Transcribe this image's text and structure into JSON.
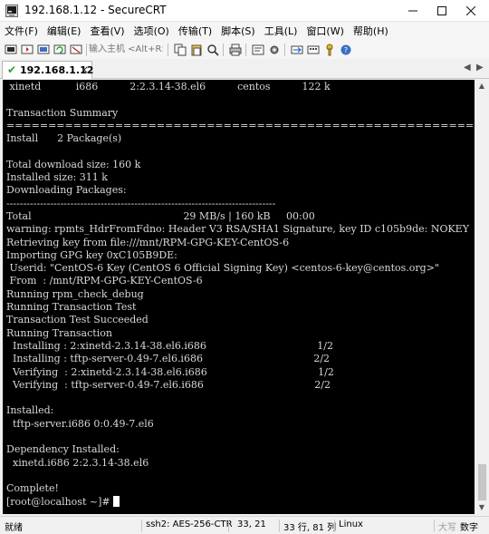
{
  "window": {
    "title": "192.168.1.12 - SecureCRT"
  },
  "menu": [
    "文件(F)",
    "编辑(E)",
    "查看(V)",
    "选项(O)",
    "传输(T)",
    "脚本(S)",
    "工具(L)",
    "窗口(W)",
    "帮助(H)"
  ],
  "toolbar": {
    "quick_connect_placeholder": "输入主机 <Alt+R>"
  },
  "tab": {
    "label": "192.168.1.12"
  },
  "terminal": {
    "lines": [
      " xinetd           i686          2:2.3.14-38.el6          centos          122 k",
      "",
      "Transaction Summary",
      "================================================================================",
      "Install      2 Package(s)",
      "",
      "Total download size: 160 k",
      "Installed size: 311 k",
      "Downloading Packages:",
      "--------------------------------------------------------------------------------",
      "Total                                                29 MB/s | 160 kB     00:00",
      "warning: rpmts_HdrFromFdno: Header V3 RSA/SHA1 Signature, key ID c105b9de: NOKEY",
      "Retrieving key from file:///mnt/RPM-GPG-KEY-CentOS-6",
      "Importing GPG key 0xC105B9DE:",
      " Userid: \"CentOS-6 Key (CentOS 6 Official Signing Key) <centos-6-key@centos.org>\"",
      " From  : /mnt/RPM-GPG-KEY-CentOS-6",
      "Running rpm_check_debug",
      "Running Transaction Test",
      "Transaction Test Succeeded",
      "Running Transaction",
      "  Installing : 2:xinetd-2.3.14-38.el6.i686                                   1/2",
      "  Installing : tftp-server-0.49-7.el6.i686                                   2/2",
      "  Verifying  : 2:xinetd-2.3.14-38.el6.i686                                   1/2",
      "  Verifying  : tftp-server-0.49-7.el6.i686                                   2/2",
      "",
      "Installed:",
      "  tftp-server.i686 0:0.49-7.el6",
      "",
      "Dependency Installed:",
      "  xinetd.i686 2:2.3.14-38.el6",
      "",
      "Complete!",
      "[root@localhost ~]# "
    ]
  },
  "status": {
    "ready": "就绪",
    "cipher": "ssh2: AES-256-CTR",
    "cursor_pos": "33,  21",
    "size": "33 行, 81 列",
    "term_type": "Linux",
    "caps": "大写",
    "num": "数字"
  }
}
